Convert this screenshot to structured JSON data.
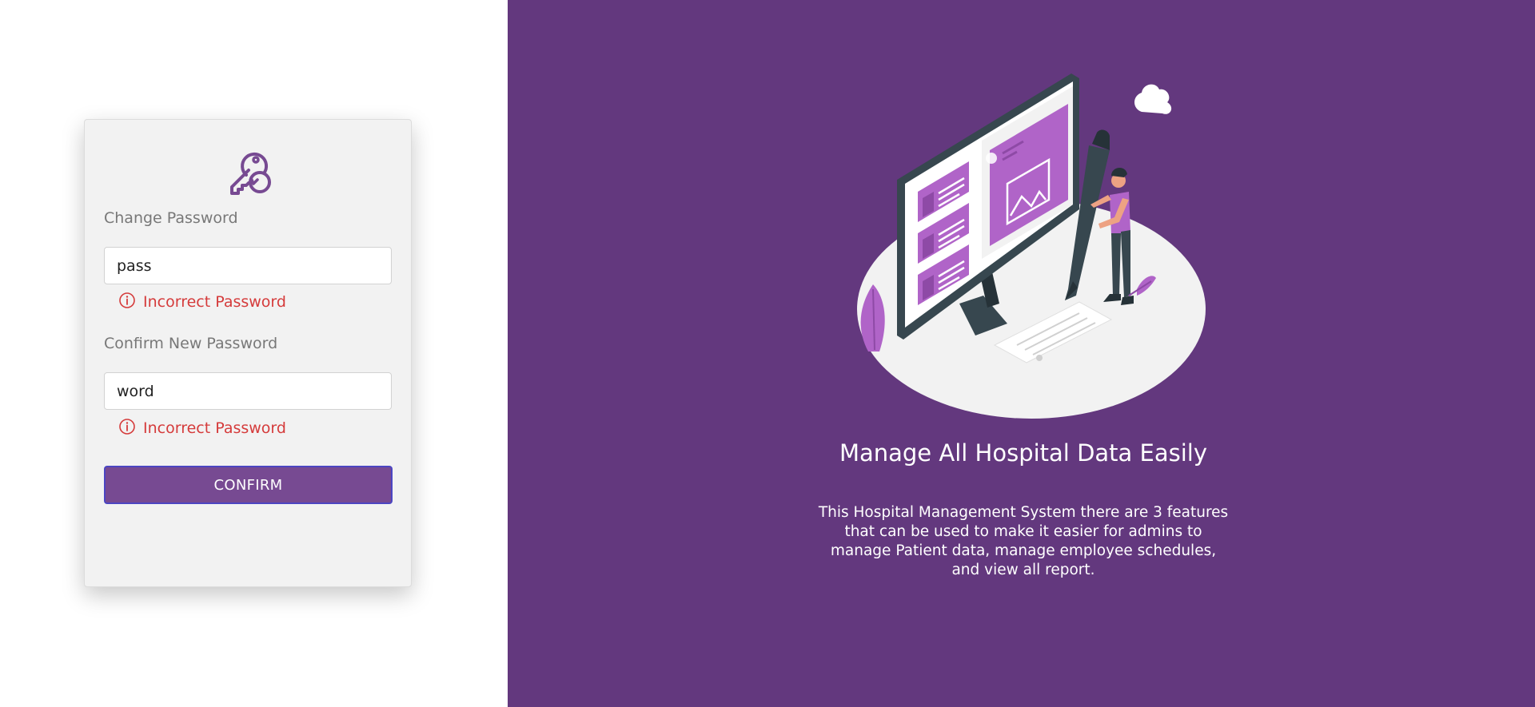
{
  "change_password": {
    "label": "Change Password",
    "value": "pass",
    "error": "Incorrect Password"
  },
  "confirm_password": {
    "label": "Confirm New Password",
    "value": "word",
    "error": "Incorrect Password"
  },
  "confirm_button": {
    "label": "CONFIRM"
  },
  "promo": {
    "headline": "Manage All Hospital Data Easily",
    "description": "This Hospital Management System there are 3 features that can be used to make it easier for admins to manage Patient data, manage employee schedules, and view all report."
  },
  "colors": {
    "brand_purple": "#63387e",
    "button_purple": "#774a92",
    "error_red": "#d53b3b",
    "accent_violet": "#b064c8"
  },
  "icons": {
    "header": "key-icon",
    "error": "info-circle-icon"
  }
}
